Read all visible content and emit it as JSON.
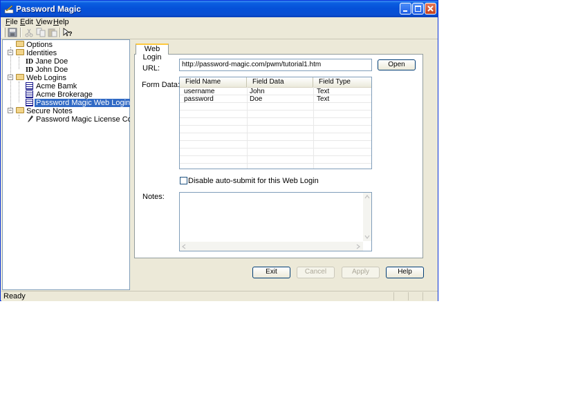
{
  "window": {
    "title": "Password Magic"
  },
  "menu": [
    {
      "label": "File",
      "accel": "F",
      "rest": "ile"
    },
    {
      "label": "Edit",
      "accel": "E",
      "rest": "dit"
    },
    {
      "label": "View",
      "accel": "V",
      "rest": "iew"
    },
    {
      "label": "Help",
      "accel": "H",
      "rest": "elp"
    }
  ],
  "toolbar": [
    "save-icon",
    "cut-icon",
    "copy-icon",
    "paste-icon",
    "help-cursor-icon"
  ],
  "tree": {
    "options": "Options",
    "identities": "Identities",
    "jane": "Jane Doe",
    "john": "John Doe",
    "id_glyph": "ID",
    "web_logins": "Web Logins",
    "acme_bank": "Acme Bamk",
    "acme_brokerage": "Acme Brokerage",
    "tutorial": "Password Magic Web Login Tutorial",
    "secure_notes": "Secure Notes",
    "license": "Password Magic License Code"
  },
  "panel": {
    "tab_label": "Web Login",
    "url_label": "URL:",
    "url_value": "http://password-magic.com/pwm/tutorial1.htm",
    "open_label": "Open",
    "form_data_label": "Form Data:",
    "columns": [
      "Field Name",
      "Field Data",
      "Field Type"
    ],
    "rows": [
      [
        "username",
        "John",
        "Text"
      ],
      [
        "password",
        "Doe",
        "Text"
      ]
    ],
    "checkbox_label": "Disable auto-submit for this Web Login",
    "notes_label": "Notes:"
  },
  "buttons": {
    "exit": "Exit",
    "cancel": "Cancel",
    "apply": "Apply",
    "help": "Help"
  },
  "status": {
    "text": "Ready"
  }
}
